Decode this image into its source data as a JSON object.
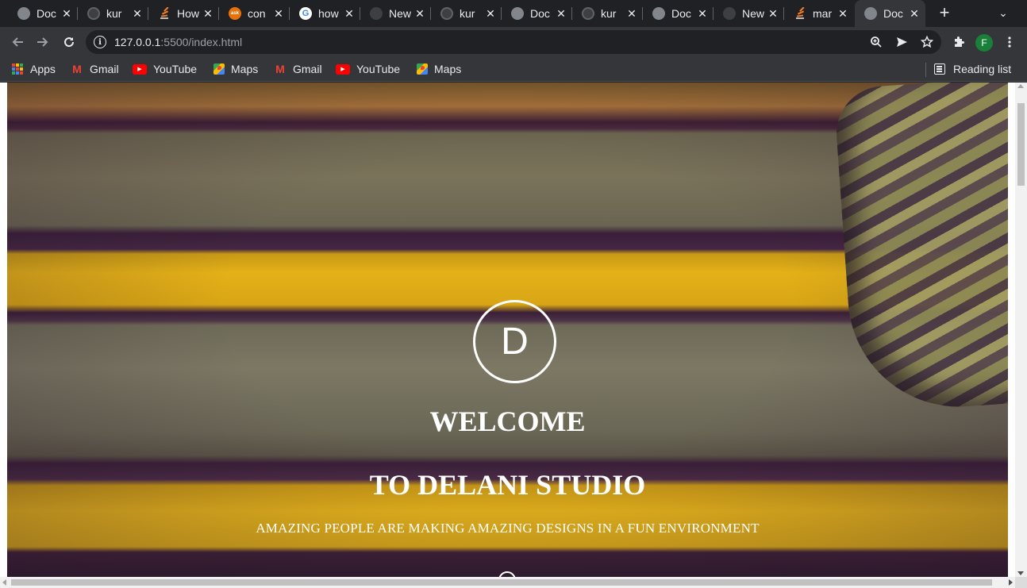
{
  "browser": {
    "tabs": [
      {
        "title": "Doc",
        "favicon": "globe-icon"
      },
      {
        "title": "kur",
        "favicon": "github-icon"
      },
      {
        "title": "How",
        "favicon": "stackoverflow-icon"
      },
      {
        "title": "con",
        "favicon": "askubuntu-icon",
        "favicon_text": "ask"
      },
      {
        "title": "how",
        "favicon": "google-icon",
        "favicon_text": "G"
      },
      {
        "title": "New",
        "favicon": "newtab-icon"
      },
      {
        "title": "kur",
        "favicon": "github-icon"
      },
      {
        "title": "Doc",
        "favicon": "globe-icon"
      },
      {
        "title": "kur",
        "favicon": "github-icon"
      },
      {
        "title": "Doc",
        "favicon": "globe-icon"
      },
      {
        "title": "New",
        "favicon": "newtab-icon"
      },
      {
        "title": "mar",
        "favicon": "stackoverflow-icon"
      },
      {
        "title": "Doc",
        "favicon": "globe-icon",
        "active": true
      }
    ],
    "close_glyph": "✕",
    "new_tab_glyph": "+",
    "tab_menu_glyph": "⌄",
    "url_host": "127.0.0.1",
    "url_rest": ":5500/index.html",
    "avatar_letter": "F",
    "bookmarks": [
      {
        "label": "Apps",
        "icon": "apps-grid-icon"
      },
      {
        "label": "Gmail",
        "icon": "gmail-icon"
      },
      {
        "label": "YouTube",
        "icon": "youtube-icon"
      },
      {
        "label": "Maps",
        "icon": "maps-icon"
      },
      {
        "label": "Gmail",
        "icon": "gmail-icon"
      },
      {
        "label": "YouTube",
        "icon": "youtube-icon"
      },
      {
        "label": "Maps",
        "icon": "maps-icon"
      }
    ],
    "reading_list": "Reading list"
  },
  "page": {
    "logo_letter": "D",
    "heading_line1": "WELCOME",
    "heading_line2": "TO DELANI STUDIO",
    "tagline": "AMAZING PEOPLE ARE MAKING AMAZING DESIGNS IN A FUN ENVIRONMENT"
  },
  "colors": {
    "chrome_dark": "#202124",
    "toolbar": "#35363a",
    "text_light": "#e8eaed",
    "avatar_bg": "#188038",
    "hero_yellow": "#e5b118",
    "hero_purple": "#3a1f38"
  }
}
